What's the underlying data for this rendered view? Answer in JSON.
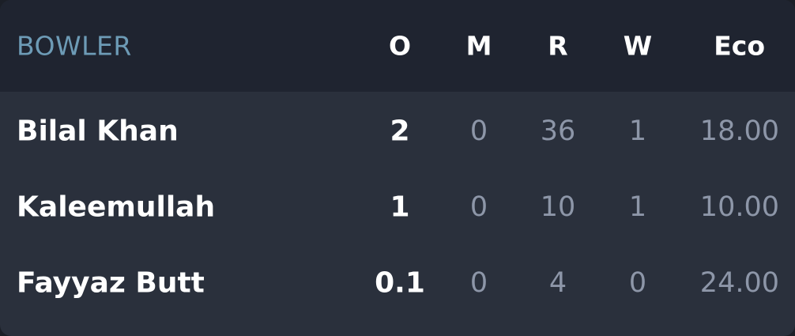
{
  "header": {
    "bowler": "BOWLER",
    "overs": "O",
    "maidens": "M",
    "runs": "R",
    "wickets": "W",
    "economy": "Eco"
  },
  "bowlers": [
    {
      "name": "Bilal Khan",
      "overs": "2",
      "maidens": "0",
      "runs": "36",
      "wickets": "1",
      "economy": "18.00"
    },
    {
      "name": "Kaleemullah",
      "overs": "1",
      "maidens": "0",
      "runs": "10",
      "wickets": "1",
      "economy": "10.00"
    },
    {
      "name": "Fayyaz Butt",
      "overs": "0.1",
      "maidens": "0",
      "runs": "4",
      "wickets": "0",
      "economy": "24.00"
    }
  ],
  "colors": {
    "card_background": "#2a303c",
    "header_background": "#1f2430",
    "header_bowler_text": "#6d9bb6",
    "primary_text": "#ffffff",
    "secondary_text": "#8d96a8"
  }
}
